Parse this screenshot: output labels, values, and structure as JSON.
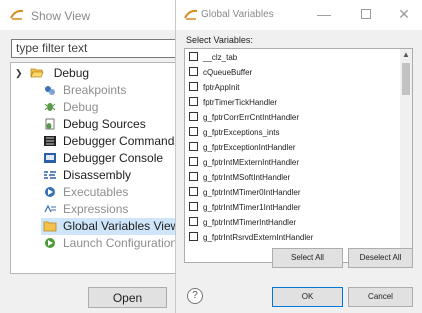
{
  "show_view": {
    "title": "Show View",
    "filter_placeholder": "type filter text",
    "tree": {
      "root_label": "Debug",
      "items": [
        {
          "label": "Breakpoints",
          "enabled": false,
          "icon": "breakpoints-icon"
        },
        {
          "label": "Debug",
          "enabled": false,
          "icon": "debug-bug-icon"
        },
        {
          "label": "Debug Sources",
          "enabled": true,
          "icon": "debug-sources-icon"
        },
        {
          "label": "Debugger Commands",
          "enabled": true,
          "icon": "debugger-commands-icon"
        },
        {
          "label": "Debugger Console",
          "enabled": true,
          "icon": "debugger-console-icon"
        },
        {
          "label": "Disassembly",
          "enabled": true,
          "icon": "disassembly-icon"
        },
        {
          "label": "Executables",
          "enabled": false,
          "icon": "executables-icon"
        },
        {
          "label": "Expressions",
          "enabled": false,
          "icon": "expressions-icon"
        },
        {
          "label": "Global Variables View",
          "enabled": true,
          "selected": true,
          "icon": "folder-icon"
        },
        {
          "label": "Launch Configurations",
          "enabled": false,
          "icon": "launch-configurations-icon"
        }
      ]
    },
    "open_label": "Open"
  },
  "global_variables": {
    "title": "Global Variables",
    "select_label": "Select Variables:",
    "variables": [
      "__clz_tab",
      "cQueueBuffer",
      "fptrAppInit",
      "fptrTimerTickHandler",
      "g_fptrCorrErrCntIntHandler",
      "g_fptrExceptions_ints",
      "g_fptrExceptionIntHandler",
      "g_fptrIntMExternIntHandler",
      "g_fptrIntMSoftIntHandler",
      "g_fptrIntMTimer0IntHandler",
      "g_fptrIntMTimer1IntHandler",
      "g_fptrIntMTimerIntHandler",
      "g_fptrIntRsrvdExternIntHandler"
    ],
    "select_all_label": "Select All",
    "deselect_all_label": "Deselect All",
    "ok_label": "OK",
    "cancel_label": "Cancel",
    "help_symbol": "?"
  },
  "colors": {
    "selection": "#cfe5fa",
    "disabled_text": "#8e8e8e",
    "focus_border": "#0078d7"
  }
}
